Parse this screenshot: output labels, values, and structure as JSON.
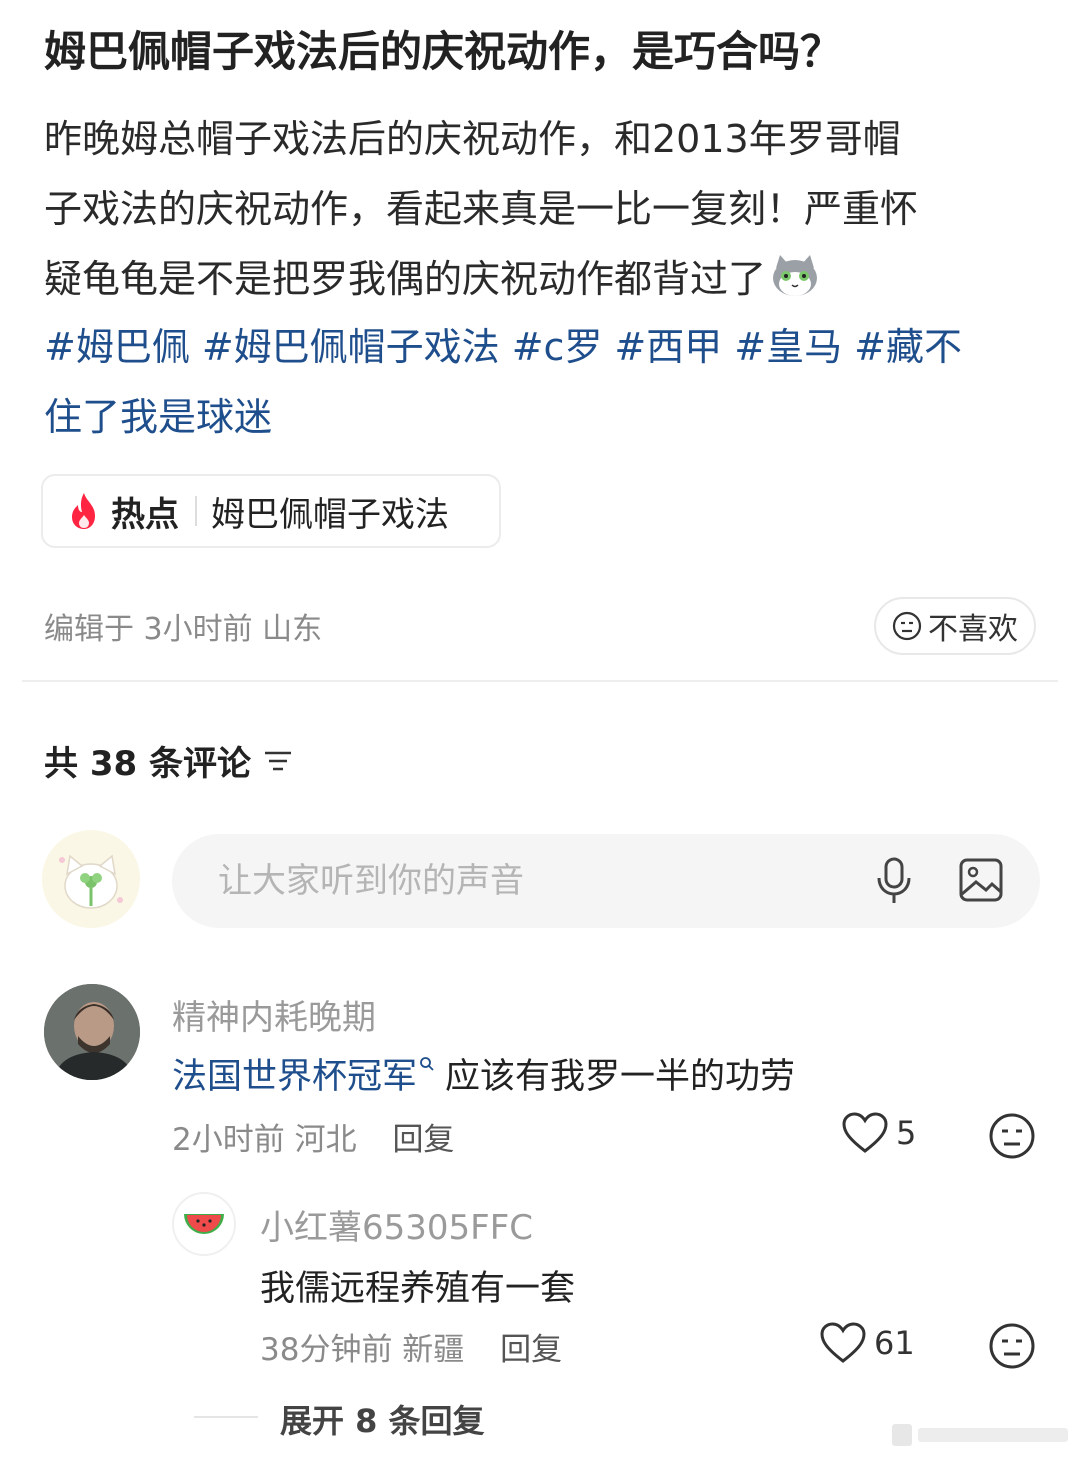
{
  "post": {
    "title": "姆巴佩帽子戏法后的庆祝动作，是巧合吗？",
    "body_lines": [
      "昨晚姆总帽子戏法后的庆祝动作，和2013年罗哥帽",
      "子戏法的庆祝动作，看起来真是一比一复刻！严重怀",
      "疑龟龟是不是把罗我偶的庆祝动作都背过了"
    ],
    "tags": [
      "#姆巴佩",
      "#姆巴佩帽子戏法",
      "#c罗",
      "#西甲",
      "#皇马",
      "#藏不",
      "住了我是球迷"
    ],
    "hot_label": "热点",
    "hot_topic": "姆巴佩帽子戏法",
    "meta": "编辑于 3小时前 山东",
    "dislike": "不喜欢"
  },
  "comments_header": {
    "count_text": "共 38 条评论"
  },
  "composer": {
    "placeholder": "让大家听到你的声音"
  },
  "comments": [
    {
      "user": "精神内耗晚期",
      "link_text": "法国世界杯冠军",
      "text": "应该有我罗一半的功劳",
      "time_loc": "2小时前 河北",
      "reply": "回复",
      "likes": "5"
    }
  ],
  "replies": [
    {
      "user": "小红薯65305FFC",
      "text": "我儒远程养殖有一套",
      "time_loc": "38分钟前 新疆",
      "reply": "回复",
      "likes": "61"
    }
  ],
  "expand_text": "展开 8 条回复",
  "colors": {
    "link": "#1f4e8c",
    "hot": "#ff2442",
    "muted": "#8a8a8a"
  }
}
